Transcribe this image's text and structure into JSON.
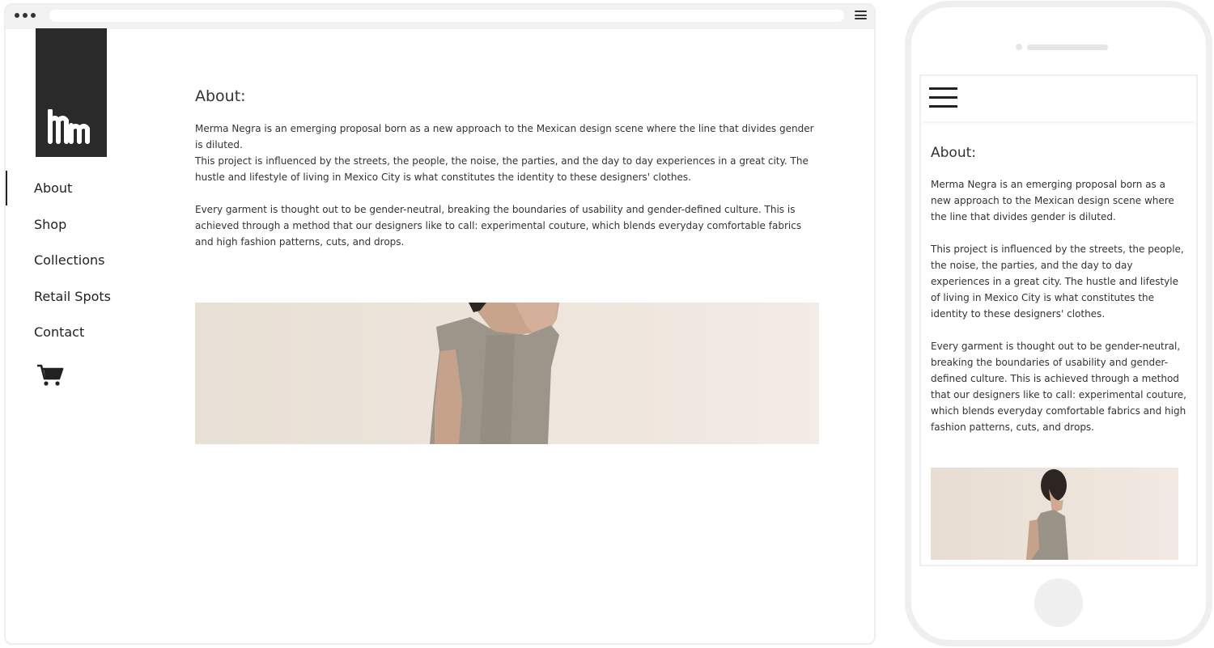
{
  "desktop": {
    "nav": [
      {
        "label": "About",
        "active": true
      },
      {
        "label": "Shop",
        "active": false
      },
      {
        "label": "Collections",
        "active": false
      },
      {
        "label": "Retail Spots",
        "active": false
      },
      {
        "label": "Contact",
        "active": false
      }
    ],
    "about": {
      "title": "About:",
      "paragraphs": [
        "Merma Negra is an emerging proposal born as a new approach to the Mexican design scene where the line that divides gender is diluted.",
        "This project is influenced by the streets, the people, the noise, the parties, and the day to day experiences in a great city. The hustle and lifestyle of living in Mexico City is what constitutes the identity to these designers' clothes.",
        "Every garment is thought out to be gender-neutral, breaking the boundaries of usability and gender-defined culture. This is achieved through a method that our designers like to call: experimental couture, which blends everyday comfortable fabrics and high fashion patterns, cuts, and drops."
      ]
    }
  },
  "mobile": {
    "about": {
      "title": "About:",
      "paragraphs": [
        "Merma Negra is an emerging proposal born as a new approach to the Mexican design scene where the line that divides gender is diluted.",
        "This project is influenced by the streets, the people, the noise, the parties, and the day to day experiences in a great city. The hustle and lifestyle of living in Mexico City is what constitutes the identity to these designers' clothes.",
        "Every garment is thought out to be gender-neutral, breaking the boundaries of usability and gender-defined culture. This is achieved through a method that our designers like to call: experimental couture, which blends everyday comfortable fabrics and high fashion patterns, cuts, and drops."
      ]
    }
  },
  "icons": {
    "logo": "mm-logo-icon",
    "cart": "cart-icon",
    "menu": "hamburger-menu-icon"
  },
  "colors": {
    "dark": "#2a2a2a",
    "text": "#333333",
    "frame": "#eeeeee"
  }
}
